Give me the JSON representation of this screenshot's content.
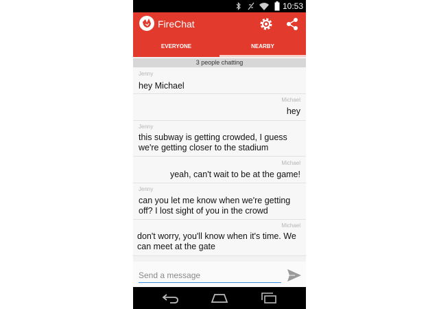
{
  "status_bar": {
    "time": "10:53",
    "icons": [
      "bluetooth-icon",
      "do-not-disturb-icon",
      "wifi-icon",
      "battery-icon"
    ]
  },
  "app_bar": {
    "title": "FireChat",
    "logo_icon": "firechat-logo-icon",
    "actions": [
      "settings-icon",
      "share-icon"
    ],
    "color": "#e23b2e"
  },
  "tabs": [
    {
      "label": "EVERYONE",
      "selected": false
    },
    {
      "label": "NEARBY",
      "selected": true
    }
  ],
  "banner": "3 people chatting",
  "messages": [
    {
      "sender": "Jenny",
      "text": "hey Michael",
      "align": "left"
    },
    {
      "sender": "Michael",
      "text": "hey",
      "align": "right"
    },
    {
      "sender": "Jenny",
      "text": "this subway is getting crowded, I guess we're getting closer to the stadium",
      "align": "left"
    },
    {
      "sender": "Michael",
      "text": "yeah, can't wait to be at the game!",
      "align": "right"
    },
    {
      "sender": "Jenny",
      "text": "can you let me know when we're getting off? I lost sight of you in the crowd",
      "align": "left"
    },
    {
      "sender": "Michael",
      "text": "don't worry, you'll know when it's time. We can meet at the gate",
      "align": "right"
    }
  ],
  "composer": {
    "placeholder": "Send a message",
    "send_icon": "send-icon"
  },
  "nav_bar": [
    "back-icon",
    "home-icon",
    "recent-apps-icon"
  ]
}
